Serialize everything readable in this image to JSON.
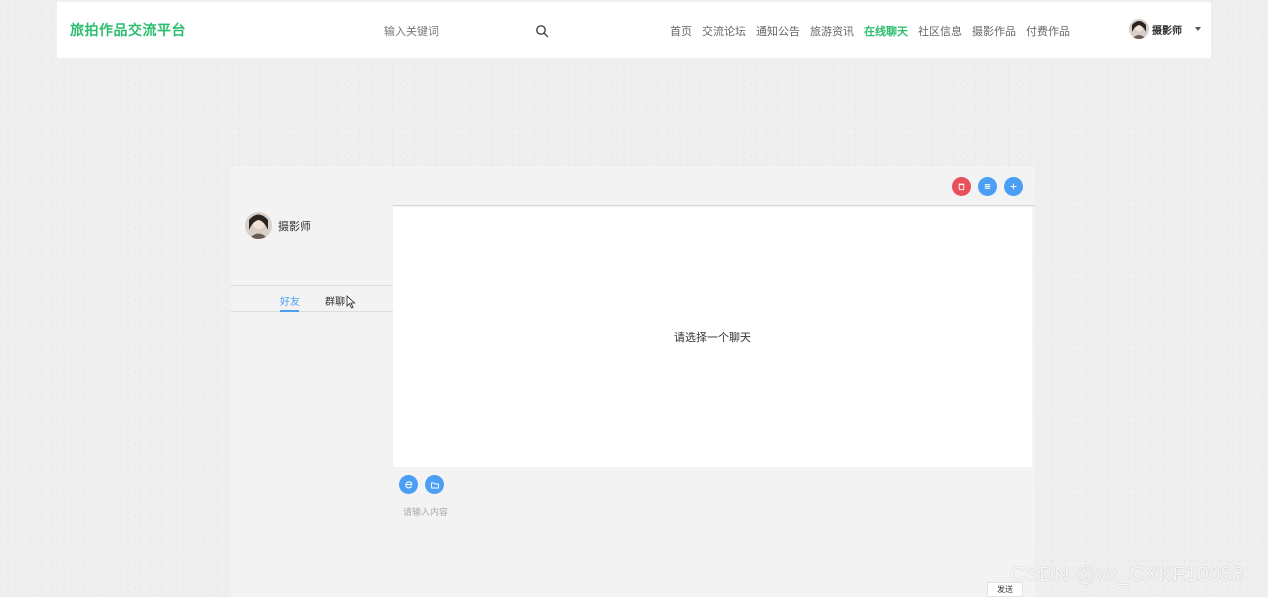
{
  "colors": {
    "brand": "#2dbd6e",
    "accent_blue": "#4a9ff5",
    "danger": "#e8505b"
  },
  "header": {
    "brand": "旅拍作品交流平台",
    "search_placeholder": "输入关键词",
    "nav": [
      {
        "label": "首页",
        "active": false
      },
      {
        "label": "交流论坛",
        "active": false
      },
      {
        "label": "通知公告",
        "active": false
      },
      {
        "label": "旅游资讯",
        "active": false
      },
      {
        "label": "在线聊天",
        "active": true
      },
      {
        "label": "社区信息",
        "active": false
      },
      {
        "label": "摄影作品",
        "active": false
      },
      {
        "label": "付费作品",
        "active": false
      }
    ],
    "user_name": "摄影师"
  },
  "chat": {
    "profile_name": "摄影师",
    "tabs": [
      {
        "label": "好友",
        "active": true
      },
      {
        "label": "群聊",
        "active": false
      }
    ],
    "empty_hint": "请选择一个聊天",
    "input_placeholder": "请输入内容",
    "send_label": "发送",
    "toolbar_icons": [
      "delete-icon",
      "list-icon",
      "plus-icon"
    ],
    "composer_icons": [
      "emoji-icon",
      "folder-icon"
    ]
  },
  "watermark": "CSDN @vx_CXKF10088"
}
